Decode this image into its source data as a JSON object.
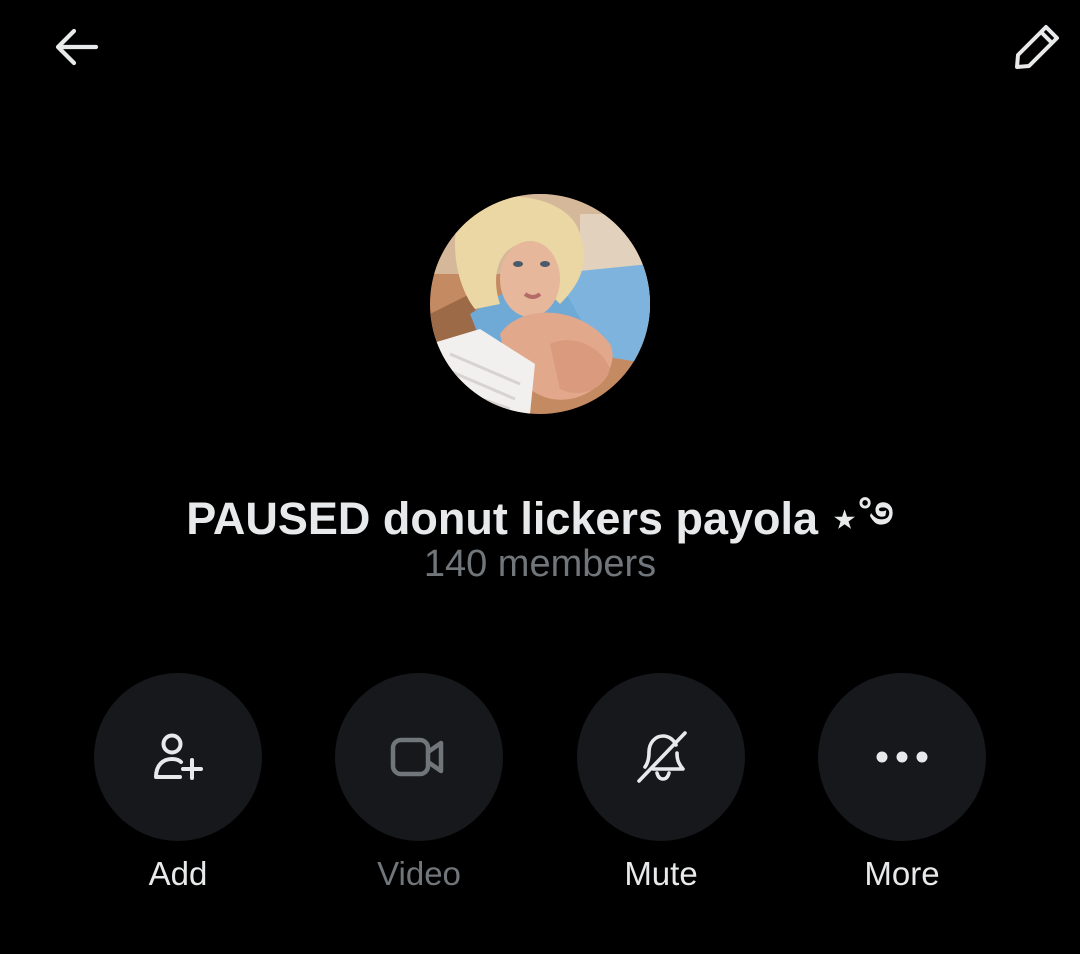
{
  "header": {
    "back_icon": "arrow-left-icon",
    "edit_icon": "pencil-icon"
  },
  "group": {
    "avatar": "group-avatar-photo",
    "name": "PAUSED donut lickers payola ⋆˚࿔",
    "members": "140 members"
  },
  "actions": [
    {
      "label": "Add",
      "icon": "add-user-icon",
      "enabled": true
    },
    {
      "label": "Video",
      "icon": "video-camera-icon",
      "enabled": false
    },
    {
      "label": "Mute",
      "icon": "bell-off-icon",
      "enabled": true
    },
    {
      "label": "More",
      "icon": "more-horizontal-icon",
      "enabled": true
    }
  ],
  "colors": {
    "background": "#000000",
    "primary_text": "#e7e9ea",
    "secondary_text": "#71767b",
    "button_fill": "#16181c"
  }
}
